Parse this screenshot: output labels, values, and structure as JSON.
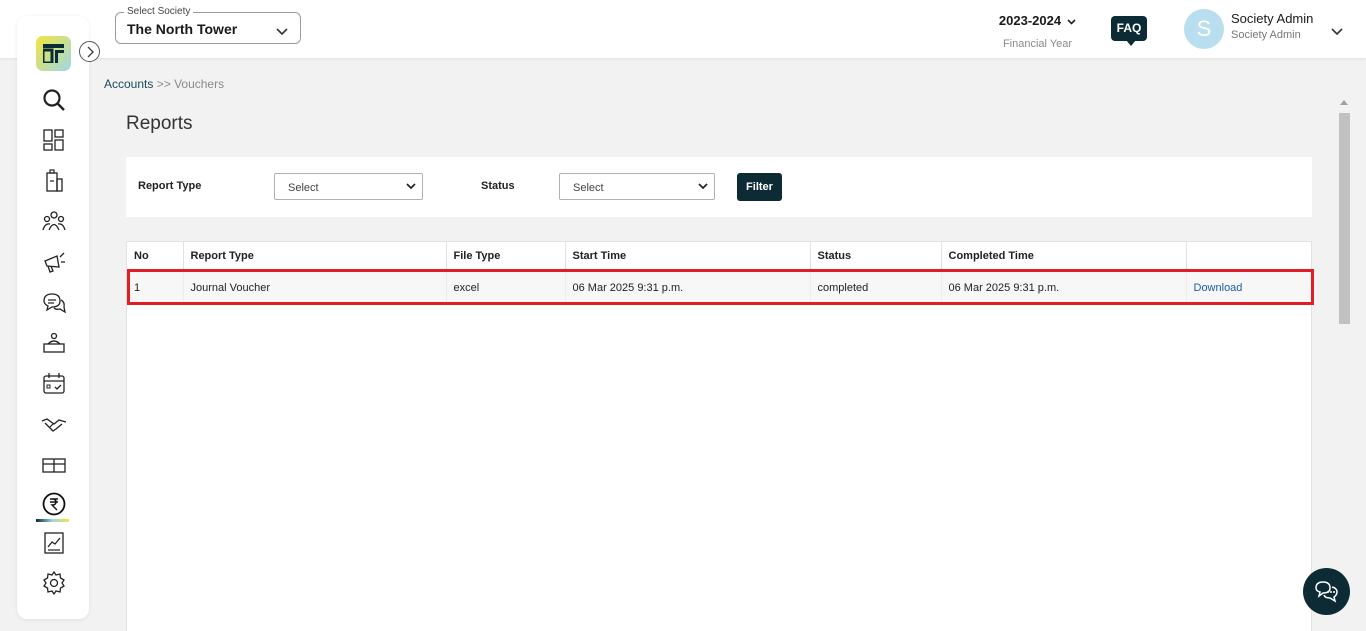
{
  "header": {
    "society_label": "Select Society",
    "society_value": "The North Tower",
    "financial_year": "2023-2024",
    "financial_year_label": "Financial Year",
    "faq_label": "FAQ",
    "avatar_letter": "S",
    "user_name": "Society Admin",
    "user_role": "Society Admin"
  },
  "sidebar": {
    "logo_text": "logo",
    "items": [
      "search-icon",
      "dashboard-icon",
      "building-icon",
      "members-icon",
      "announcement-icon",
      "chat-icon",
      "amenity-icon",
      "calendar-icon",
      "handshake-icon",
      "parcel-icon",
      "rupee-icon",
      "reports-icon",
      "settings-icon"
    ],
    "active_item": "rupee-icon"
  },
  "breadcrumb": {
    "parent": "Accounts",
    "separator": ">>",
    "current": "Vouchers"
  },
  "page_title": "Reports",
  "filters": {
    "report_type_label": "Report Type",
    "report_type_value": "Select",
    "status_label": "Status",
    "status_value": "Select",
    "filter_button": "Filter"
  },
  "table": {
    "headers": [
      "No",
      "Report Type",
      "File Type",
      "Start Time",
      "Status",
      "Completed Time",
      ""
    ],
    "rows": [
      {
        "no": "1",
        "report_type": "Journal Voucher",
        "file_type": "excel",
        "start_time": "06 Mar 2025 9:31 p.m.",
        "status": "completed",
        "completed_time": "06 Mar 2025 9:31 p.m.",
        "action": "Download"
      }
    ]
  },
  "colors": {
    "brand_dark": "#0c2b34",
    "highlight": "#e01e26",
    "link": "#1c5fa8"
  }
}
